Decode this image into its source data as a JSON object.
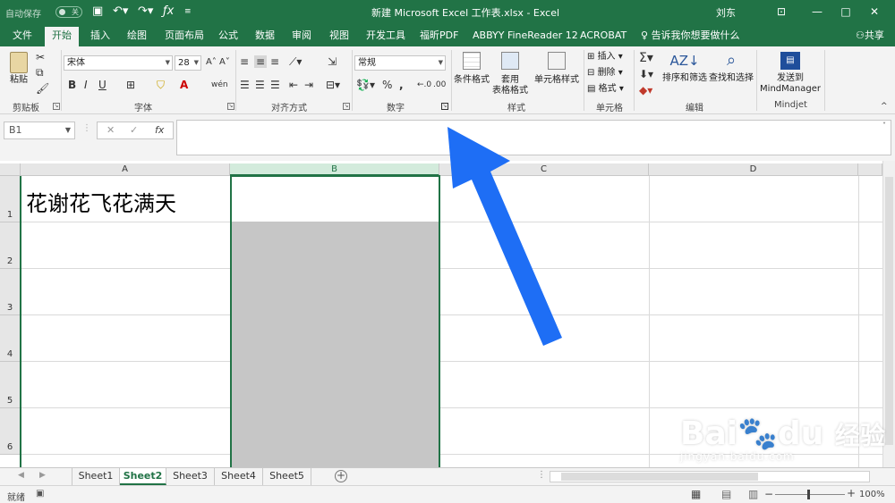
{
  "titlebar": {
    "autosave_label": "自动保存",
    "autosave_state": "关",
    "title": "新建 Microsoft Excel 工作表.xlsx  -  Excel",
    "user": "刘东"
  },
  "tabs": [
    "文件",
    "开始",
    "插入",
    "绘图",
    "页面布局",
    "公式",
    "数据",
    "审阅",
    "视图",
    "开发工具",
    "福昕PDF",
    "ABBYY FineReader 12",
    "ACROBAT"
  ],
  "tell_me": "告诉我你想要做什么",
  "share": "共享",
  "ribbon": {
    "paste": "粘贴",
    "font_name": "宋体",
    "font_size": "28",
    "number_format": "常规",
    "groups": {
      "clipboard": "剪贴板",
      "font": "字体",
      "alignment": "对齐方式",
      "number": "数字",
      "styles": "样式",
      "cells": "单元格",
      "editing": "编辑",
      "mindjet": "Mindjet"
    },
    "conditional_format": "条件格式",
    "table_format_1": "套用",
    "table_format_2": "表格格式",
    "cell_styles": "单元格样式",
    "insert": "插入",
    "delete": "删除",
    "format": "格式",
    "sort_filter": "排序和筛选",
    "find_select": "查找和选择",
    "send_to_1": "发送到",
    "send_to_2": "MindManager"
  },
  "formula_bar": {
    "name_box": "B1",
    "fx": "fx",
    "value": ""
  },
  "columns": [
    "A",
    "B",
    "C",
    "D"
  ],
  "rows": [
    "1",
    "2",
    "3",
    "4",
    "5",
    "6"
  ],
  "cells": {
    "A1": "花谢花飞花满天"
  },
  "sheets": [
    "Sheet1",
    "Sheet2",
    "Sheet3",
    "Sheet4",
    "Sheet5"
  ],
  "active_sheet": "Sheet2",
  "status": {
    "ready": "就绪",
    "zoom": "100%"
  },
  "watermark": {
    "brand": "Bai",
    "brand_cn": "经验",
    "url": "jingyan.baidu.com"
  },
  "colors": {
    "excel_green": "#217346",
    "arrow_blue": "#1e6ef5"
  }
}
